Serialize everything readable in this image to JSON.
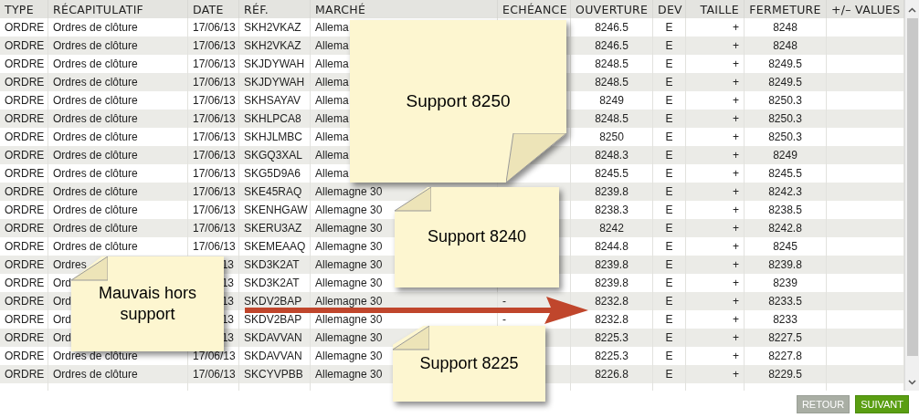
{
  "table": {
    "columns": [
      "TYPE",
      "RÉCAPITULATIF",
      "DATE",
      "RÉF.",
      "MARCHÉ",
      "ECHÉANCE",
      "OUVERTURE",
      "DEV",
      "TAILLE",
      "FERMETURE",
      "+/– VALUES"
    ],
    "rows": [
      {
        "type": "ORDRE",
        "summary": "Ordres de clôture",
        "date": "17/06/13",
        "ref": "SKH2VKAZ",
        "market": "Allema",
        "due": "",
        "open": "8246.5",
        "dev": "E",
        "size": "+",
        "close": "8248"
      },
      {
        "type": "ORDRE",
        "summary": "Ordres de clôture",
        "date": "17/06/13",
        "ref": "SKH2VKAZ",
        "market": "Allema",
        "due": "",
        "open": "8246.5",
        "dev": "E",
        "size": "+",
        "close": "8248"
      },
      {
        "type": "ORDRE",
        "summary": "Ordres de clôture",
        "date": "17/06/13",
        "ref": "SKJDYWAH",
        "market": "Allema",
        "due": "",
        "open": "8248.5",
        "dev": "E",
        "size": "+",
        "close": "8249.5"
      },
      {
        "type": "ORDRE",
        "summary": "Ordres de clôture",
        "date": "17/06/13",
        "ref": "SKJDYWAH",
        "market": "Allema",
        "due": "",
        "open": "8248.5",
        "dev": "E",
        "size": "+",
        "close": "8249.5"
      },
      {
        "type": "ORDRE",
        "summary": "Ordres de clôture",
        "date": "17/06/13",
        "ref": "SKHSAYAV",
        "market": "Allema",
        "due": "",
        "open": "8249",
        "dev": "E",
        "size": "+",
        "close": "8250.3"
      },
      {
        "type": "ORDRE",
        "summary": "Ordres de clôture",
        "date": "17/06/13",
        "ref": "SKHLPCA8",
        "market": "Allema",
        "due": "",
        "open": "8248.5",
        "dev": "E",
        "size": "+",
        "close": "8250.3"
      },
      {
        "type": "ORDRE",
        "summary": "Ordres de clôture",
        "date": "17/06/13",
        "ref": "SKHJLMBC",
        "market": "Allema",
        "due": "",
        "open": "8250",
        "dev": "E",
        "size": "+",
        "close": "8250.3"
      },
      {
        "type": "ORDRE",
        "summary": "Ordres de clôture",
        "date": "17/06/13",
        "ref": "SKGQ3XAL",
        "market": "Allema",
        "due": "",
        "open": "8248.3",
        "dev": "E",
        "size": "+",
        "close": "8249"
      },
      {
        "type": "ORDRE",
        "summary": "Ordres de clôture",
        "date": "17/06/13",
        "ref": "SKG5D9A6",
        "market": "Allema",
        "due": "",
        "open": "8245.5",
        "dev": "E",
        "size": "+",
        "close": "8245.5"
      },
      {
        "type": "ORDRE",
        "summary": "Ordres de clôture",
        "date": "17/06/13",
        "ref": "SKE45RAQ",
        "market": "Allemagne 30",
        "due": "",
        "open": "8239.8",
        "dev": "E",
        "size": "+",
        "close": "8242.3"
      },
      {
        "type": "ORDRE",
        "summary": "Ordres de clôture",
        "date": "17/06/13",
        "ref": "SKENHGAW",
        "market": "Allemagne 30",
        "due": "",
        "open": "8238.3",
        "dev": "E",
        "size": "+",
        "close": "8238.5"
      },
      {
        "type": "ORDRE",
        "summary": "Ordres de clôture",
        "date": "17/06/13",
        "ref": "SKERU3AZ",
        "market": "Allemagne 30",
        "due": "",
        "open": "8242",
        "dev": "E",
        "size": "+",
        "close": "8242.8"
      },
      {
        "type": "ORDRE",
        "summary": "Ordres de clôture",
        "date": "17/06/13",
        "ref": "SKEMEAAQ",
        "market": "Allemagne 30",
        "due": "",
        "open": "8244.8",
        "dev": "E",
        "size": "+",
        "close": "8245"
      },
      {
        "type": "ORDRE",
        "summary": "Ordres",
        "date": "13",
        "ref": "SKD3K2AT",
        "market": "Allemagne 30",
        "due": "",
        "open": "8239.8",
        "dev": "E",
        "size": "+",
        "close": "8239.8"
      },
      {
        "type": "ORDRE",
        "summary": "Ord",
        "date": "13",
        "ref": "SKD3K2AT",
        "market": "Allemagne 30",
        "due": "",
        "open": "8239.8",
        "dev": "E",
        "size": "+",
        "close": "8239"
      },
      {
        "type": "ORDRE",
        "summary": "Ord",
        "date": "13",
        "ref": "SKDV2BAP",
        "market": "Allemagne 30",
        "due": "-",
        "open": "8232.8",
        "dev": "E",
        "size": "+",
        "close": "8233.5"
      },
      {
        "type": "ORDRE",
        "summary": "Ord",
        "date": "13",
        "ref": "SKDV2BAP",
        "market": "Allemagne 30",
        "due": "-",
        "open": "8232.8",
        "dev": "E",
        "size": "+",
        "close": "8233"
      },
      {
        "type": "ORDRE",
        "summary": "Ord",
        "date": "13",
        "ref": "SKDAVVAN",
        "market": "Allemagne 30",
        "due": "",
        "open": "8225.3",
        "dev": "E",
        "size": "+",
        "close": "8227.5"
      },
      {
        "type": "ORDRE",
        "summary": "Ordres de clôture",
        "date": "17/06/13",
        "ref": "SKDAVVAN",
        "market": "Allemagne 30",
        "due": "",
        "open": "8225.3",
        "dev": "E",
        "size": "+",
        "close": "8227.8"
      },
      {
        "type": "ORDRE",
        "summary": "Ordres de clôture",
        "date": "17/06/13",
        "ref": "SKCYVPBB",
        "market": "Allemagne 30",
        "due": "",
        "open": "8226.8",
        "dev": "E",
        "size": "+",
        "close": "8229.5"
      }
    ]
  },
  "notes": [
    {
      "text": "Support 8250"
    },
    {
      "text": "Support 8240"
    },
    {
      "text": "Mauvais hors support"
    },
    {
      "text": "Support 8225"
    }
  ],
  "buttons": [
    {
      "label": "RETOUR",
      "disabled": true
    },
    {
      "label": "SUIVANT",
      "disabled": false
    }
  ]
}
